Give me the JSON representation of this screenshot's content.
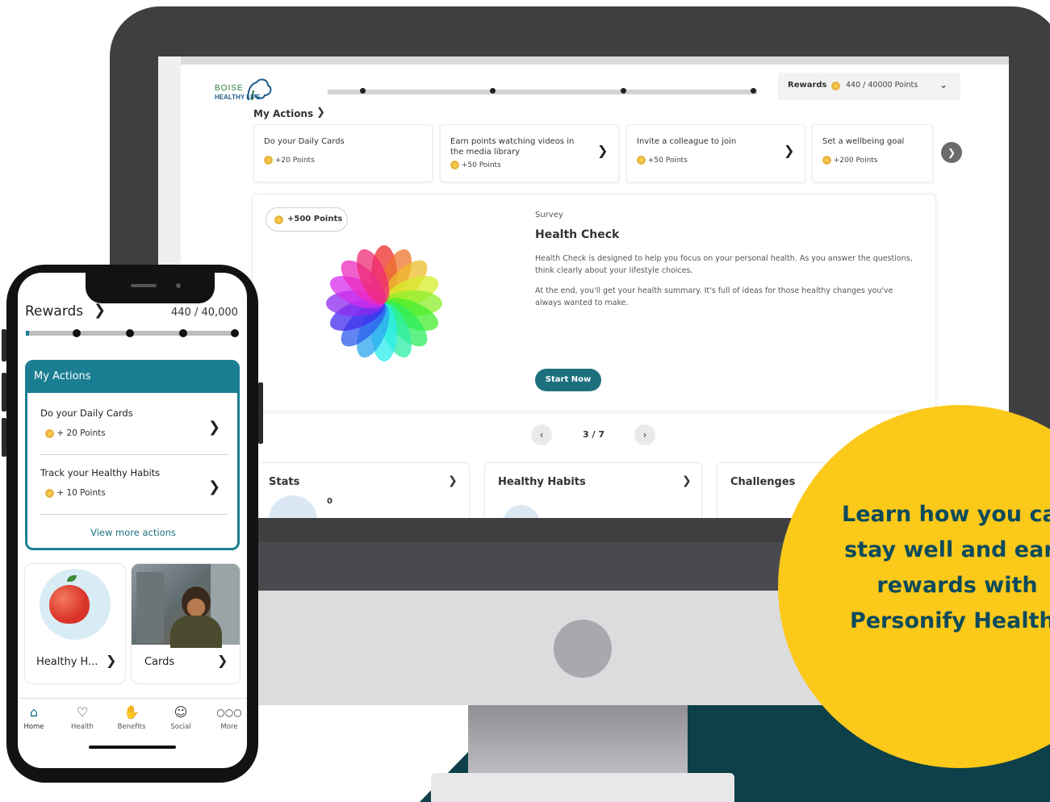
{
  "colors": {
    "teal_dark": "#0d4048",
    "teal_accent": "#1a7e93",
    "promo_yellow": "#fbc91a",
    "promo_text": "#0d4b5c",
    "bezel": "#3f3f42"
  },
  "desktop": {
    "logo": {
      "line1": "BOISE",
      "line2": "HEALTHY LIFE"
    },
    "rewards": {
      "label": "Rewards",
      "points": "440 / 40000 Points"
    },
    "my_actions_title": "My Actions",
    "actions": [
      {
        "title": "Do your Daily Cards",
        "points": "+20 Points"
      },
      {
        "title": "Earn points watching videos in the media library",
        "points": "+50 Points"
      },
      {
        "title": "Invite a colleague to join",
        "points": "+50 Points"
      },
      {
        "title": "Set a wellbeing goal",
        "points": "+200 Points"
      }
    ],
    "survey": {
      "badge": "+500 Points",
      "type": "Survey",
      "title": "Health Check",
      "p1": "Health Check is designed to help you focus on your personal health. As you answer the questions, think clearly about your lifestyle choices.",
      "p2": "At the end, you'll get your health summary. It's full of ideas for those healthy changes you've always wanted to make.",
      "button": "Start Now"
    },
    "pager": "3 / 7",
    "bottom_cards": [
      {
        "title": "Stats",
        "value": "0"
      },
      {
        "title": "Healthy Habits"
      },
      {
        "title": "Challenges"
      }
    ]
  },
  "promo": {
    "text": "Learn how you can stay well and earn rewards with Personify Health!"
  },
  "phone": {
    "rewards_label": "Rewards",
    "points": "440 / 40,000",
    "progress_fraction": 0.011,
    "my_actions_title": "My Actions",
    "items": [
      {
        "title": "Do your Daily Cards",
        "points": "+ 20 Points"
      },
      {
        "title": "Track your Healthy Habits",
        "points": "+ 10 Points"
      }
    ],
    "view_more": "View more actions",
    "tiles": [
      {
        "label": "Healthy H..."
      },
      {
        "label": "Cards"
      }
    ],
    "nav": [
      {
        "label": "Home",
        "icon": "home-icon"
      },
      {
        "label": "Health",
        "icon": "heart-icon"
      },
      {
        "label": "Benefits",
        "icon": "hand-heart-icon"
      },
      {
        "label": "Social",
        "icon": "people-icon"
      },
      {
        "label": "More",
        "icon": "more-icon"
      }
    ]
  }
}
